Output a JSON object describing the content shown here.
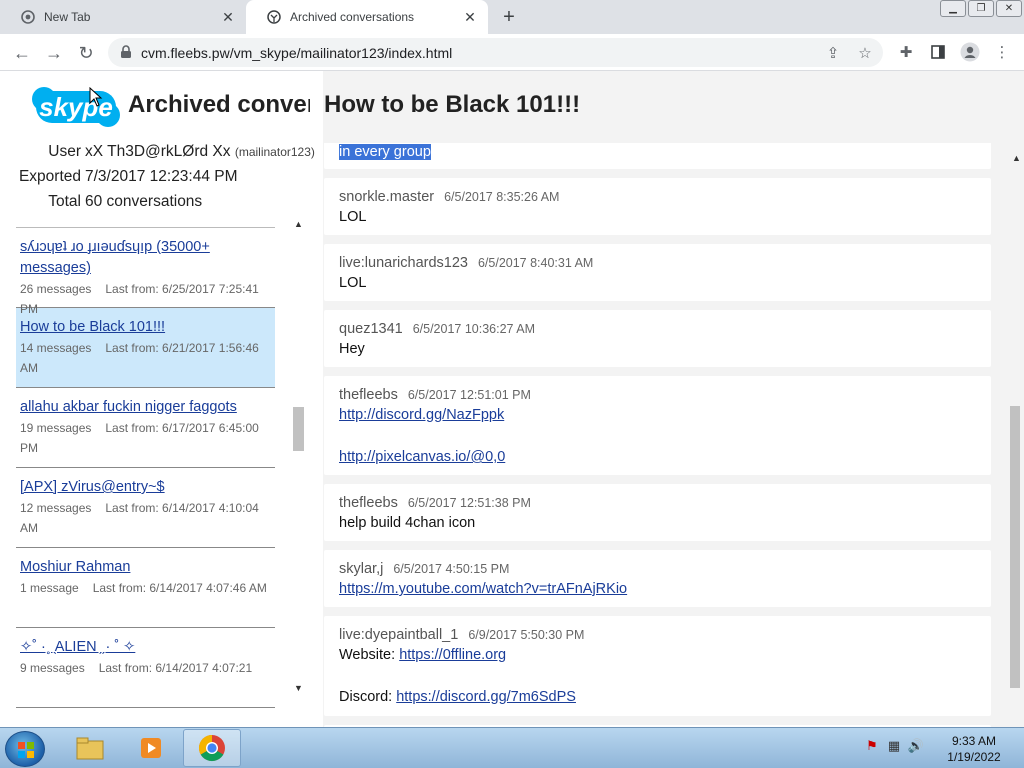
{
  "browser": {
    "tabs": [
      {
        "title": "New Tab",
        "active": false
      },
      {
        "title": "Archived conversations",
        "active": true
      }
    ],
    "url": "cvm.fleebs.pw/vm_skype/mailinator123/index.html"
  },
  "header": {
    "logo_text": "skype",
    "title": "Archived conversations",
    "conversation_title": "How to be Black 101!!!"
  },
  "meta": {
    "user_label": "User",
    "user_value": "xX Th3D@rkLØrd Xx",
    "user_handle": "(mailinator123)",
    "exported_label": "Exported",
    "exported_value": "7/3/2017 12:23:44 PM",
    "total_label": "Total",
    "total_value": "60 conversations"
  },
  "conversations": [
    {
      "name": "sʎɹɔɥɐʇ ɹo ɟɹıǝuɗsɥıp (35000+ messages)",
      "count": "26 messages",
      "last": "Last from: 6/25/2017 7:25:41 PM",
      "active": false
    },
    {
      "name": "How to be Black 101!!!",
      "count": "14 messages",
      "last": "Last from: 6/21/2017 1:56:46 AM",
      "active": true
    },
    {
      "name": "allahu akbar fuckin nigger faggots",
      "count": "19 messages",
      "last": "Last from: 6/17/2017 6:45:00 PM",
      "active": false
    },
    {
      "name": "[APX] zVirus@entry~$",
      "count": "12 messages",
      "last": "Last from: 6/14/2017 4:10:04 AM",
      "active": false
    },
    {
      "name": "Moshiur Rahman",
      "count": "1 message",
      "last": "Last from: 6/14/2017 4:07:46 AM",
      "active": false
    },
    {
      "name": "✧˚ ·˳ ̖ALIEN ̗ˏ· ˚ ✧",
      "count": "9 messages",
      "last": "Last from: 6/14/2017 4:07:21",
      "active": false
    }
  ],
  "messages": [
    {
      "author": "",
      "time": "",
      "lines": [
        {
          "text": "in every group",
          "selected": true
        }
      ]
    },
    {
      "author": "snorkle.master",
      "time": "6/5/2017 8:35:26 AM",
      "lines": [
        {
          "text": "LOL"
        }
      ]
    },
    {
      "author": "live:lunarichards123",
      "time": "6/5/2017 8:40:31 AM",
      "lines": [
        {
          "text": "LOL"
        }
      ]
    },
    {
      "author": "quez1341",
      "time": "6/5/2017 10:36:27 AM",
      "lines": [
        {
          "text": "Hey"
        }
      ]
    },
    {
      "author": "thefleebs",
      "time": "6/5/2017 12:51:01 PM",
      "lines": [
        {
          "link": "http://discord.gg/NazFppk"
        },
        {
          "gap": true
        },
        {
          "link": "http://pixelcanvas.io/@0,0"
        }
      ]
    },
    {
      "author": "thefleebs",
      "time": "6/5/2017 12:51:38 PM",
      "lines": [
        {
          "text": "help build 4chan icon"
        }
      ]
    },
    {
      "author": "skylar,j",
      "time": "6/5/2017 4:50:15 PM",
      "lines": [
        {
          "link": "https://m.youtube.com/watch?v=trAFnAjRKio"
        }
      ]
    },
    {
      "author": "live:dyepaintball_1",
      "time": "6/9/2017 5:50:30 PM",
      "lines": [
        {
          "text": "Website: ",
          "link": "https://0ffline.org"
        },
        {
          "gap": true
        },
        {
          "text": "Discord: ",
          "link": "https://discord.gg/7m6SdPS"
        }
      ]
    }
  ],
  "taskbar": {
    "time": "9:33 AM",
    "date": "1/19/2022"
  },
  "colors": {
    "link": "#1a3d99",
    "active_conversation": "#cce8fb",
    "selection": "#3b73d8",
    "skype_blue": "#00aff0"
  }
}
